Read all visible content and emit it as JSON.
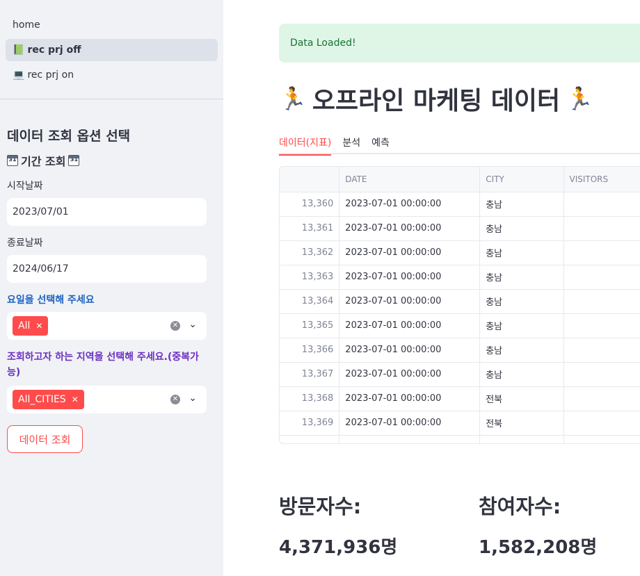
{
  "sidebar": {
    "nav": [
      {
        "icon": "",
        "label": "home",
        "active": false
      },
      {
        "icon": "📗",
        "label": "rec prj off",
        "active": true
      },
      {
        "icon": "💻",
        "label": "rec prj on",
        "active": false
      }
    ],
    "section_title": "데이터 조회 옵션 선택",
    "period_title": "기간 조회",
    "start_label": "시작날짜",
    "start_value": "2023/07/01",
    "end_label": "종료날짜",
    "end_value": "2024/06/17",
    "weekday_label": "요일을 선택해 주세요",
    "weekday_chip": "All",
    "region_label": "조회하고자 하는 지역을 선택해 주세요.(중복가능)",
    "region_chip": "All_CITIES",
    "query_button": "데이터 조회"
  },
  "main": {
    "alert": "Data Loaded!",
    "title": "오프라인 마케팅 데이터",
    "tabs": [
      "데이터(지표)",
      "분석",
      "예측"
    ],
    "table": {
      "columns": [
        "",
        "DATE",
        "CITY",
        "VISITORS"
      ],
      "rows": [
        [
          "13,360",
          "2023-07-01 00:00:00",
          "충남",
          ""
        ],
        [
          "13,361",
          "2023-07-01 00:00:00",
          "충남",
          ""
        ],
        [
          "13,362",
          "2023-07-01 00:00:00",
          "충남",
          ""
        ],
        [
          "13,363",
          "2023-07-01 00:00:00",
          "충남",
          ""
        ],
        [
          "13,364",
          "2023-07-01 00:00:00",
          "충남",
          ""
        ],
        [
          "13,365",
          "2023-07-01 00:00:00",
          "충남",
          ""
        ],
        [
          "13,366",
          "2023-07-01 00:00:00",
          "충남",
          ""
        ],
        [
          "13,367",
          "2023-07-01 00:00:00",
          "충남",
          ""
        ],
        [
          "13,368",
          "2023-07-01 00:00:00",
          "전북",
          ""
        ],
        [
          "13,369",
          "2023-07-01 00:00:00",
          "전북",
          ""
        ],
        [
          "",
          "",
          "",
          ""
        ]
      ]
    },
    "metrics": [
      {
        "label": "방문자수:",
        "value": "4,371,936명"
      },
      {
        "label": "참여자수:",
        "value": "1,582,208명"
      }
    ]
  },
  "colors": {
    "accent": "#ff4b4b",
    "sidebar_bg": "#f0f2f6",
    "success_bg": "#dff6e7",
    "success_text": "#177233"
  }
}
